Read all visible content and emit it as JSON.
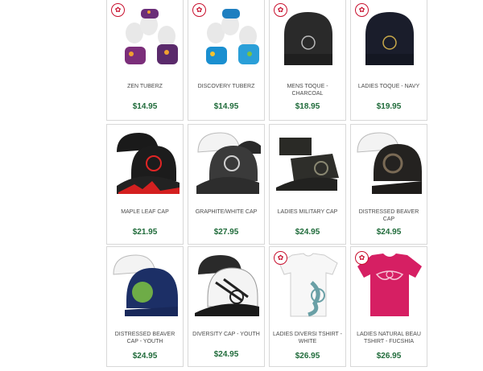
{
  "colors": {
    "price": "#1f6b3a",
    "name": "#4a4a4a",
    "border": "#d8d8d8",
    "leaf": "#c8102e"
  },
  "products": [
    {
      "name": "ZEN TUBERZ",
      "price": "$14.95",
      "badge": "maple-leaf-badge"
    },
    {
      "name": "DISCOVERY TUBERZ",
      "price": "$14.95",
      "badge": "maple-leaf-badge"
    },
    {
      "name": "MENS TOQUE - CHARCOAL",
      "price": "$18.95",
      "badge": "maple-leaf-badge"
    },
    {
      "name": "LADIES TOQUE - NAVY",
      "price": "$19.95",
      "badge": "maple-leaf-badge"
    },
    {
      "name": "MAPLE LEAF CAP",
      "price": "$21.95"
    },
    {
      "name": "GRAPHITE/WHITE CAP",
      "price": "$27.95"
    },
    {
      "name": "LADIES MILITARY CAP",
      "price": "$24.95"
    },
    {
      "name": "DISTRESSED BEAVER CAP",
      "price": "$24.95"
    },
    {
      "name": "DISTRESSED BEAVER CAP - YOUTH",
      "price": "$24.95"
    },
    {
      "name": "DIVERSITY CAP - YOUTH",
      "price": "$24.95"
    },
    {
      "name": "LADIES DIVERSI TSHIRT - WHITE",
      "price": "$26.95",
      "badge": "maple-leaf-badge"
    },
    {
      "name": "LADIES NATURAL BEAU TSHIRT - FUCSHIA",
      "price": "$26.95",
      "badge": "maple-leaf-badge"
    }
  ]
}
